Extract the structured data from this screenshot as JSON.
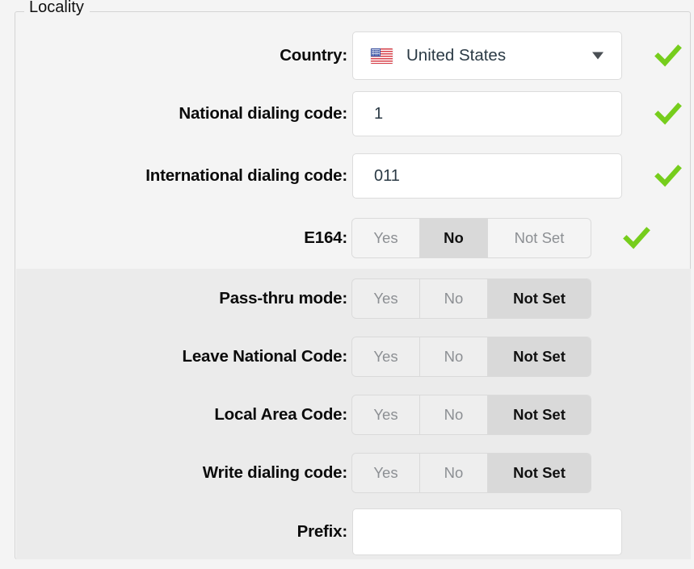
{
  "fieldset": {
    "legend": "Locality"
  },
  "colors": {
    "check_green": "#76cd1c",
    "band_light": "#f4f4f4",
    "band_dark": "#ebebeb",
    "selected_button": "#d9d9d9",
    "input_background": "#ffffff",
    "border": "#d4d4d4"
  },
  "toggle_options": {
    "yes": "Yes",
    "no": "No",
    "not_set": "Not Set"
  },
  "rows": [
    {
      "id": "country",
      "label": "Country:",
      "type": "select",
      "value": "United States",
      "flag": "us-flag-icon",
      "caret": "chevron-down-icon",
      "valid": true
    },
    {
      "id": "national-dialing-code",
      "label": "National dialing code:",
      "type": "text",
      "value": "1",
      "placeholder": "",
      "valid": true
    },
    {
      "id": "international-dialing-code",
      "label": "International dialing code:",
      "type": "text",
      "value": "011",
      "placeholder": "",
      "valid": true
    },
    {
      "id": "e164",
      "label": "E164:",
      "type": "toggle",
      "selected": "No",
      "valid": true
    },
    {
      "id": "pass-thru-mode",
      "label": "Pass-thru mode:",
      "type": "toggle",
      "selected": "Not Set",
      "valid": false
    },
    {
      "id": "leave-national-code",
      "label": "Leave National Code:",
      "type": "toggle",
      "selected": "Not Set",
      "valid": false
    },
    {
      "id": "local-area-code",
      "label": "Local Area Code:",
      "type": "toggle",
      "selected": "Not Set",
      "valid": false
    },
    {
      "id": "write-dialing-code",
      "label": "Write dialing code:",
      "type": "toggle",
      "selected": "Not Set",
      "valid": false
    },
    {
      "id": "prefix",
      "label": "Prefix:",
      "type": "text",
      "value": "",
      "placeholder": "",
      "valid": false
    }
  ]
}
